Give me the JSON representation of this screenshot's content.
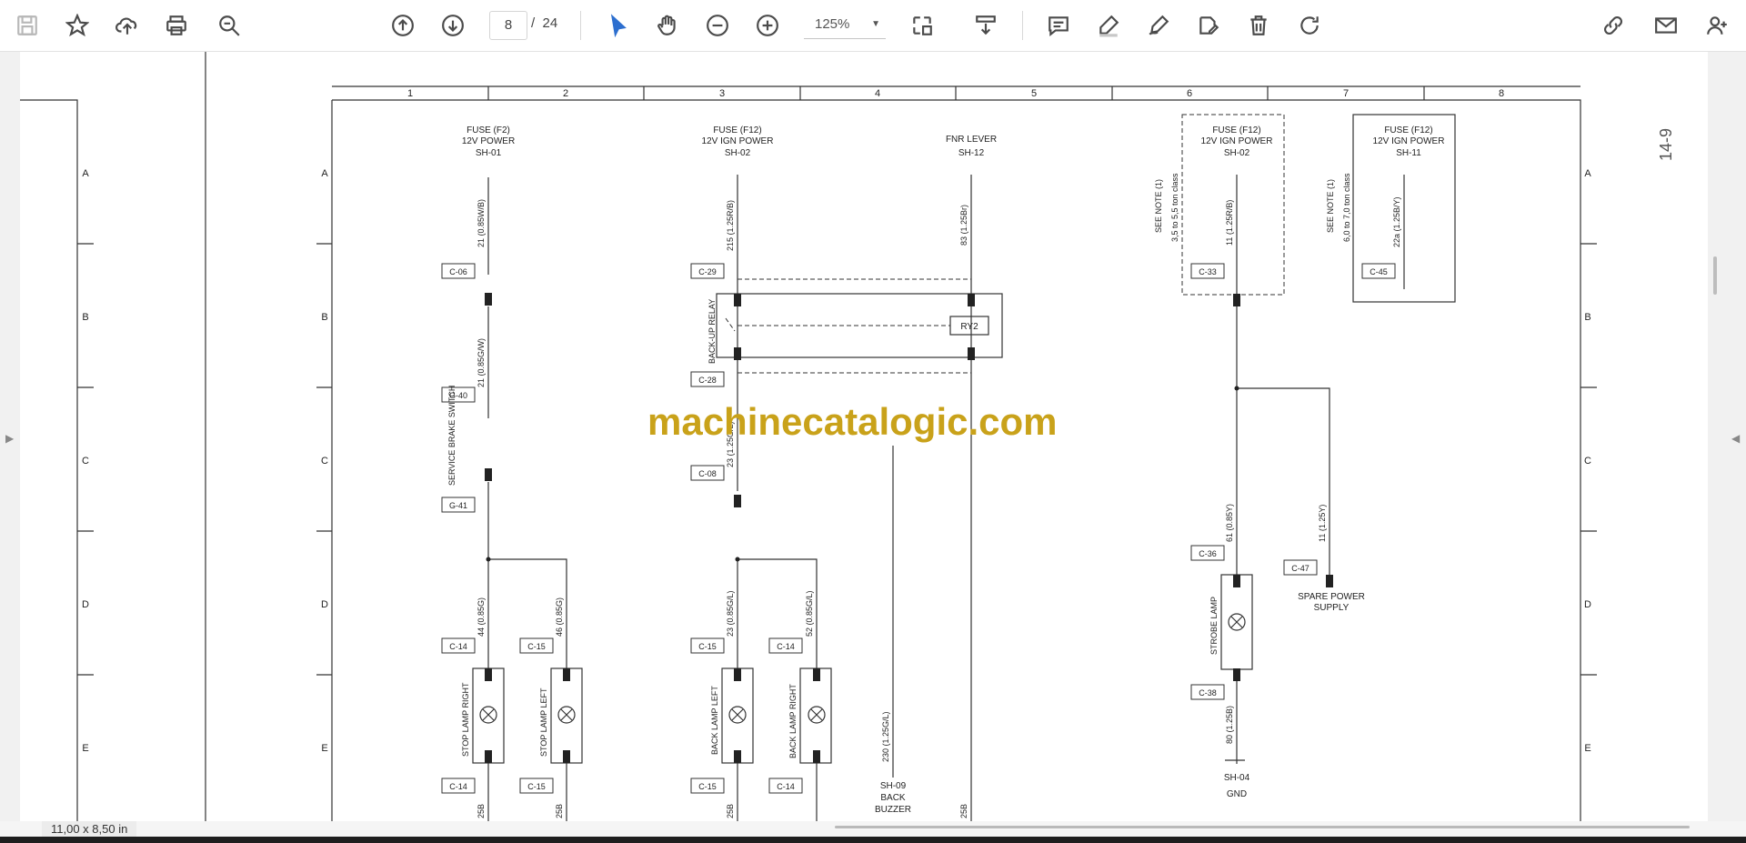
{
  "toolbar": {
    "icons": [
      "save-icon",
      "star-icon",
      "upload-cloud-icon",
      "print-icon",
      "zoom-search-icon",
      "prev-page-icon",
      "next-page-icon",
      "select-arrow-icon",
      "hand-tool-icon",
      "zoom-out-icon",
      "zoom-in-icon",
      "fit-page-icon",
      "scroll-mode-icon",
      "comment-icon",
      "highlight-pen-icon",
      "draw-icon",
      "sign-icon",
      "delete-icon",
      "rotate-icon",
      "share-link-icon",
      "mail-icon",
      "add-user-icon"
    ],
    "page_current": "8",
    "page_separator": "/",
    "page_total": "24",
    "zoom": "125%"
  },
  "status": {
    "page_size": "11,00 x 8,50 in"
  },
  "watermark": "machinecatalogic.com",
  "sheet_number": "14-9",
  "schematic": {
    "columns": [
      "1",
      "2",
      "3",
      "4",
      "5",
      "6",
      "7",
      "8"
    ],
    "rows": [
      "A",
      "B",
      "C",
      "D",
      "E"
    ],
    "sources": [
      {
        "l1": "FUSE (F2)",
        "l2": "12V POWER",
        "l3": "SH-01"
      },
      {
        "l1": "FUSE (F12)",
        "l2": "12V IGN POWER",
        "l3": "SH-02"
      },
      {
        "l1": "FNR LEVER",
        "l2": "SH-12"
      },
      {
        "l1": "FUSE (F12)",
        "l2": "12V IGN POWER",
        "l3": "SH-02"
      },
      {
        "l1": "FUSE (F12)",
        "l2": "12V IGN POWER",
        "l3": "SH-11"
      }
    ],
    "notes": [
      {
        "l1": "SEE NOTE (1)",
        "l2": "3,5 to 5,5 ton class"
      },
      {
        "l1": "SEE NOTE (1)",
        "l2": "6,0 to 7,0 ton class"
      }
    ],
    "wires": [
      "21 (0.85W/B)",
      "21 (0.85G/W)",
      "215 (1.25R/B)",
      "83 (1.25Br)",
      "11 (1.25R/B)",
      "22a (1.25B/Y)",
      "23 (1.25G/L)",
      "44 (0.85G)",
      "46 (0.85G)",
      "23 (0.85G/L)",
      "52 (0.85G/L)",
      "230 (1.25G/L)",
      "61 (0.85Y)",
      "11 (1.25Y)",
      "80 (1.25B)",
      "25B"
    ],
    "connectors": [
      "C-06",
      "G-40",
      "G-41",
      "C-29",
      "C-28",
      "C-08",
      "C-33",
      "C-45",
      "C-14",
      "C-15",
      "C-15",
      "C-14",
      "C-14",
      "C-15",
      "C-15",
      "C-14",
      "C-36",
      "C-38",
      "C-47"
    ],
    "components": [
      "SERVICE BRAKE SWITCH",
      "BACK-UP RELAY",
      "RY2",
      "STOP LAMP RIGHT",
      "STOP LAMP LEFT",
      "BACK LAMP LEFT",
      "BACK LAMP RIGHT",
      "STROBE LAMP"
    ],
    "labels": {
      "back_buzzer": [
        "SH-09",
        "BACK",
        "BUZZER"
      ],
      "spare_power": [
        "SPARE POWER",
        "SUPPLY"
      ],
      "gnd": [
        "SH-04",
        "GND"
      ]
    }
  }
}
